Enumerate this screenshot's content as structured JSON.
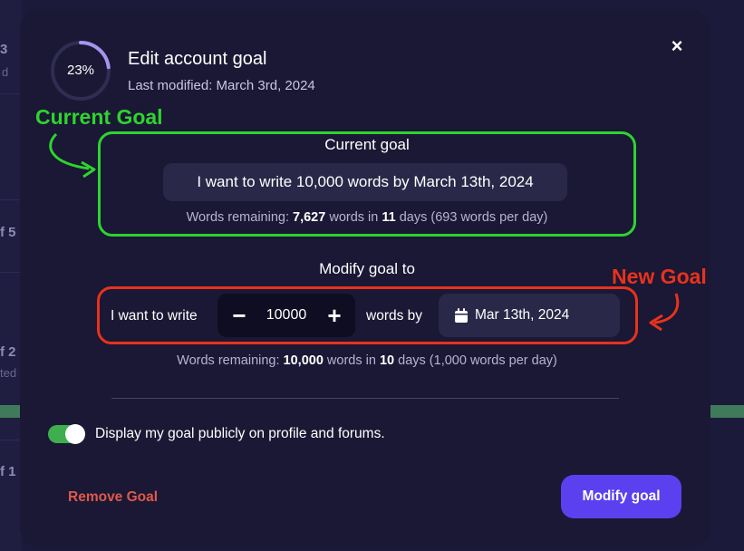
{
  "background": {
    "fragments": [
      "3",
      "r d",
      "f 5",
      "f 2",
      "ted",
      "f 1"
    ]
  },
  "modal": {
    "progress_percent": 23,
    "progress_label": "23%",
    "title": "Edit account goal",
    "last_modified": "Last modified: March 3rd, 2024",
    "close_label": "×"
  },
  "annotations": {
    "current_goal_label": "Current Goal",
    "new_goal_label": "New Goal",
    "colors": {
      "green": "#2ed42e",
      "red": "#e8321d"
    }
  },
  "current_goal": {
    "heading": "Current goal",
    "statement": "I want to write 10,000 words by March 13th, 2024",
    "remaining": {
      "prefix": "Words remaining: ",
      "words": "7,627",
      "mid": " words in ",
      "days": "11",
      "suffix": " days (693 words per day)"
    }
  },
  "modify_goal": {
    "heading": "Modify goal to",
    "prefix": "I want to write",
    "minus_label": "−",
    "value": "10000",
    "plus_label": "+",
    "words_by": "words by",
    "date": "Mar 13th, 2024",
    "date_icon": "calendar-icon",
    "remaining": {
      "prefix": "Words remaining: ",
      "words": "10,000",
      "mid": " words in ",
      "days": "10",
      "suffix": " days (1,000 words per day)"
    }
  },
  "public_toggle": {
    "on": true,
    "label": "Display my goal publicly on profile and forums."
  },
  "actions": {
    "remove": "Remove Goal",
    "modify": "Modify goal"
  },
  "colors": {
    "background": "#1c1a3a",
    "modal": "#1a1834",
    "accent": "#5b40f0",
    "toggle_on": "#3fae4f",
    "danger": "#e0584a",
    "progress_ring": "#a694f0"
  }
}
